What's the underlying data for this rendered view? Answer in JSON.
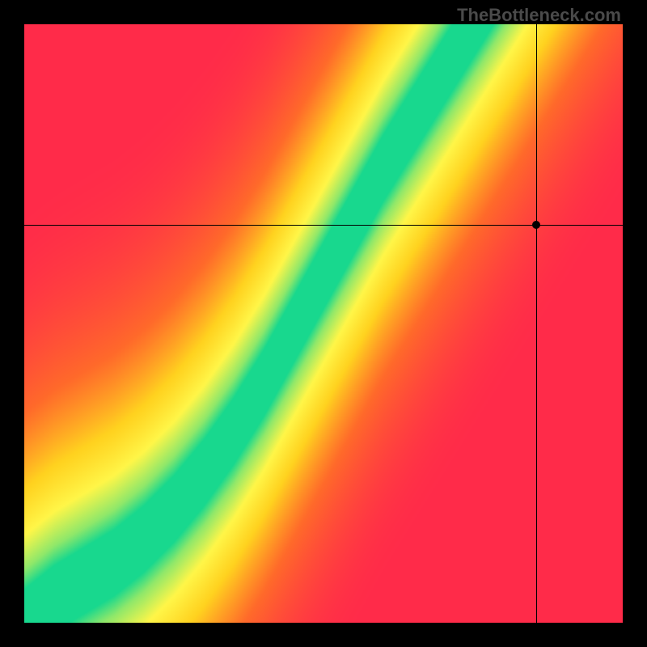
{
  "watermark": "TheBottleneck.com",
  "chart_data": {
    "type": "heatmap",
    "title": "",
    "xlabel": "",
    "ylabel": "",
    "xlim": [
      0,
      1
    ],
    "ylim": [
      0,
      1
    ],
    "color_stops": [
      {
        "t": 0.0,
        "color": "#ff2b49"
      },
      {
        "t": 0.3,
        "color": "#ff6a2a"
      },
      {
        "t": 0.55,
        "color": "#ffd21f"
      },
      {
        "t": 0.74,
        "color": "#fff648"
      },
      {
        "t": 0.9,
        "color": "#8fe86a"
      },
      {
        "t": 1.0,
        "color": "#18d88e"
      }
    ],
    "optimal_curve": [
      {
        "x": 0.0,
        "y": 0.0
      },
      {
        "x": 0.05,
        "y": 0.04
      },
      {
        "x": 0.1,
        "y": 0.07
      },
      {
        "x": 0.15,
        "y": 0.1
      },
      {
        "x": 0.2,
        "y": 0.14
      },
      {
        "x": 0.25,
        "y": 0.19
      },
      {
        "x": 0.3,
        "y": 0.25
      },
      {
        "x": 0.35,
        "y": 0.32
      },
      {
        "x": 0.4,
        "y": 0.4
      },
      {
        "x": 0.45,
        "y": 0.49
      },
      {
        "x": 0.5,
        "y": 0.58
      },
      {
        "x": 0.55,
        "y": 0.67
      },
      {
        "x": 0.6,
        "y": 0.76
      },
      {
        "x": 0.65,
        "y": 0.84
      },
      {
        "x": 0.7,
        "y": 0.92
      },
      {
        "x": 0.75,
        "y": 1.0
      }
    ],
    "band_half_width": 0.055,
    "marker": {
      "x": 0.855,
      "y": 0.665
    },
    "crosshair": {
      "x": 0.855,
      "y": 0.665
    }
  }
}
